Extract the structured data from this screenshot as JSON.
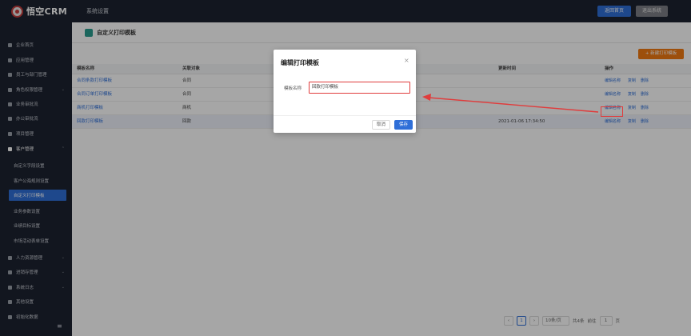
{
  "app": {
    "logo_text": "悟空CRM",
    "section_title": "系统设置"
  },
  "topbar": {
    "home_label": "返回首页",
    "exit_label": "退出系统"
  },
  "sidebar": {
    "items": [
      {
        "label": "企业首页",
        "chevron": false
      },
      {
        "label": "应用管理",
        "chevron": false
      },
      {
        "label": "员工与部门管理",
        "chevron": false
      },
      {
        "label": "角色权限管理",
        "chevron": true
      },
      {
        "label": "业务审批流",
        "chevron": false
      },
      {
        "label": "办公审批流",
        "chevron": false
      },
      {
        "label": "项目管理",
        "chevron": false
      },
      {
        "label": "客户管理",
        "chevron": true
      }
    ],
    "sub_items": [
      {
        "label": "自定义字段设置",
        "active": false
      },
      {
        "label": "客户公海规则设置",
        "active": false
      },
      {
        "label": "自定义打印模板",
        "active": true
      },
      {
        "label": "业务参数设置",
        "active": false
      },
      {
        "label": "业绩目标设置",
        "active": false
      },
      {
        "label": "市场活动表单设置",
        "active": false
      }
    ],
    "bottom_items": [
      {
        "label": "人力资源管理",
        "chevron": true
      },
      {
        "label": "进销存管理",
        "chevron": true
      },
      {
        "label": "系统日志",
        "chevron": true
      },
      {
        "label": "其他设置",
        "chevron": false
      },
      {
        "label": "初始化数据",
        "chevron": false
      }
    ]
  },
  "page": {
    "title": "自定义打印模板",
    "new_button": "+ 新建打印模板"
  },
  "table": {
    "headers": [
      "模板名称",
      "关联对象",
      "更新时间",
      "操作"
    ],
    "rows": [
      {
        "name": "合同条款打印模板",
        "object": "合同",
        "time": ""
      },
      {
        "name": "合同订单打印模板",
        "object": "合同",
        "time": ""
      },
      {
        "name": "商机打印模板",
        "object": "商机",
        "time": ""
      },
      {
        "name": "回款打印模板",
        "object": "回款",
        "time": "2021-01-06 17:34:50"
      }
    ],
    "actions": {
      "edit": "编辑名称",
      "copy": "复制",
      "delete": "删除"
    }
  },
  "pagination": {
    "current_page": "1",
    "page_size": "10条/页",
    "total": "共4条",
    "goto_label": "前往",
    "goto_value": "1",
    "page_unit": "页"
  },
  "modal": {
    "title": "编辑打印模板",
    "field_label": "模板名称",
    "field_value": "回款打印模板",
    "cancel_label": "取消",
    "save_label": "保存"
  },
  "colors": {
    "primary": "#2f6fd8",
    "sidebar_bg": "#1d2330",
    "orange": "#f27a12",
    "highlight": "#e03c3c"
  }
}
